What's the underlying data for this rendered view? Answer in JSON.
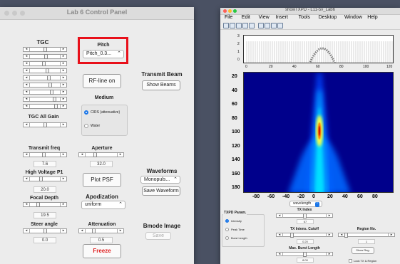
{
  "left_panel": {
    "title": "Lab 6 Control Panel",
    "tgc": {
      "label": "TGC",
      "levels": [
        0.5,
        0.55,
        0.45,
        0.6,
        0.65,
        0.7,
        0.75,
        0.85,
        0.9
      ]
    },
    "tgc_all_gain": {
      "label": "TGC All Gain",
      "level": 0.5
    },
    "pitch": {
      "label": "Pitch",
      "selected": "Pitch_0.3..."
    },
    "rf_line_button": "RF-line on",
    "medium": {
      "label": "Medium",
      "options": [
        "CIRS (attenuative)",
        "Water"
      ],
      "selected": 0
    },
    "transmit_beam": {
      "label": "Transmit Beam",
      "button": "Show Beams"
    },
    "transmit_freq": {
      "label": "Transmit freq",
      "value": "7.6",
      "level": 0.45
    },
    "aperture": {
      "label": "Aperture",
      "value": "32.0",
      "level": 0.3
    },
    "high_voltage": {
      "label": "High Voltage P1",
      "value": "20.0",
      "level": 0.35
    },
    "plot_psf_button": "Plot PSF",
    "waveforms": {
      "label": "Waveforms",
      "selected": "Monopuls...",
      "save_button": "Save Waveform"
    },
    "focal_depth": {
      "label": "Focal Depth",
      "value": "19.5",
      "level": 0.25
    },
    "apodization": {
      "label": "Apodization",
      "selected": "uniform"
    },
    "steer_angle": {
      "label": "Steer angle",
      "value": "0.0",
      "level": 0.5
    },
    "attenuation": {
      "label": "Attenuation",
      "value": "0.5",
      "level": 0.25
    },
    "bmode_image": {
      "label": "Bmode Image",
      "save_button": "Save"
    },
    "freeze_button": "Freeze",
    "colors": {
      "highlight": "#e8101a",
      "freeze_text": "#e02020",
      "window_bg": "#ececec"
    }
  },
  "right_window": {
    "title": "showTXPD - L11-5v_Lab6",
    "menu": [
      "File",
      "Edit",
      "View",
      "Insert",
      "Tools",
      "Desktop",
      "Window",
      "Help"
    ],
    "toolbar_icons": [
      "new-file-icon",
      "open-icon",
      "save-icon",
      "print-icon",
      "zoom-in-icon",
      "zoom-out-icon",
      "pan-icon",
      "data-cursor-icon",
      "insert-colorbar-icon"
    ],
    "top_plot": {
      "y_ticks": [
        "3",
        "2",
        "1",
        "0"
      ],
      "x_ticks": [
        "0",
        "20",
        "40",
        "60",
        "80",
        "100",
        "120"
      ]
    },
    "main_plot": {
      "y_ticks": [
        "20",
        "40",
        "60",
        "80",
        "100",
        "120",
        "140",
        "160",
        "180"
      ],
      "x_ticks": [
        "-80",
        "-60",
        "-40",
        "-20",
        "0",
        "20",
        "40",
        "60",
        "80"
      ],
      "unit_selected": "wavelength"
    },
    "txpd_param": {
      "label": "TXPD Param.",
      "options": [
        "Intensity",
        "Peak Time",
        "Burst Length"
      ],
      "selected": 0
    },
    "tx_index": {
      "label": "TX Index",
      "value": "67",
      "level": 0.5
    },
    "tx_intens_cutoff": {
      "label": "TX Intens. Cutoff",
      "value": "0.20",
      "level": 0.2
    },
    "max_burst_length": {
      "label": "Max. Burst Length",
      "value": "8.00",
      "level": 0.5
    },
    "region_no": {
      "label": "Region No.",
      "value": "1",
      "level": 0.0,
      "button": "Show Reg."
    },
    "lock_checkbox": "Lock TX & Region"
  }
}
